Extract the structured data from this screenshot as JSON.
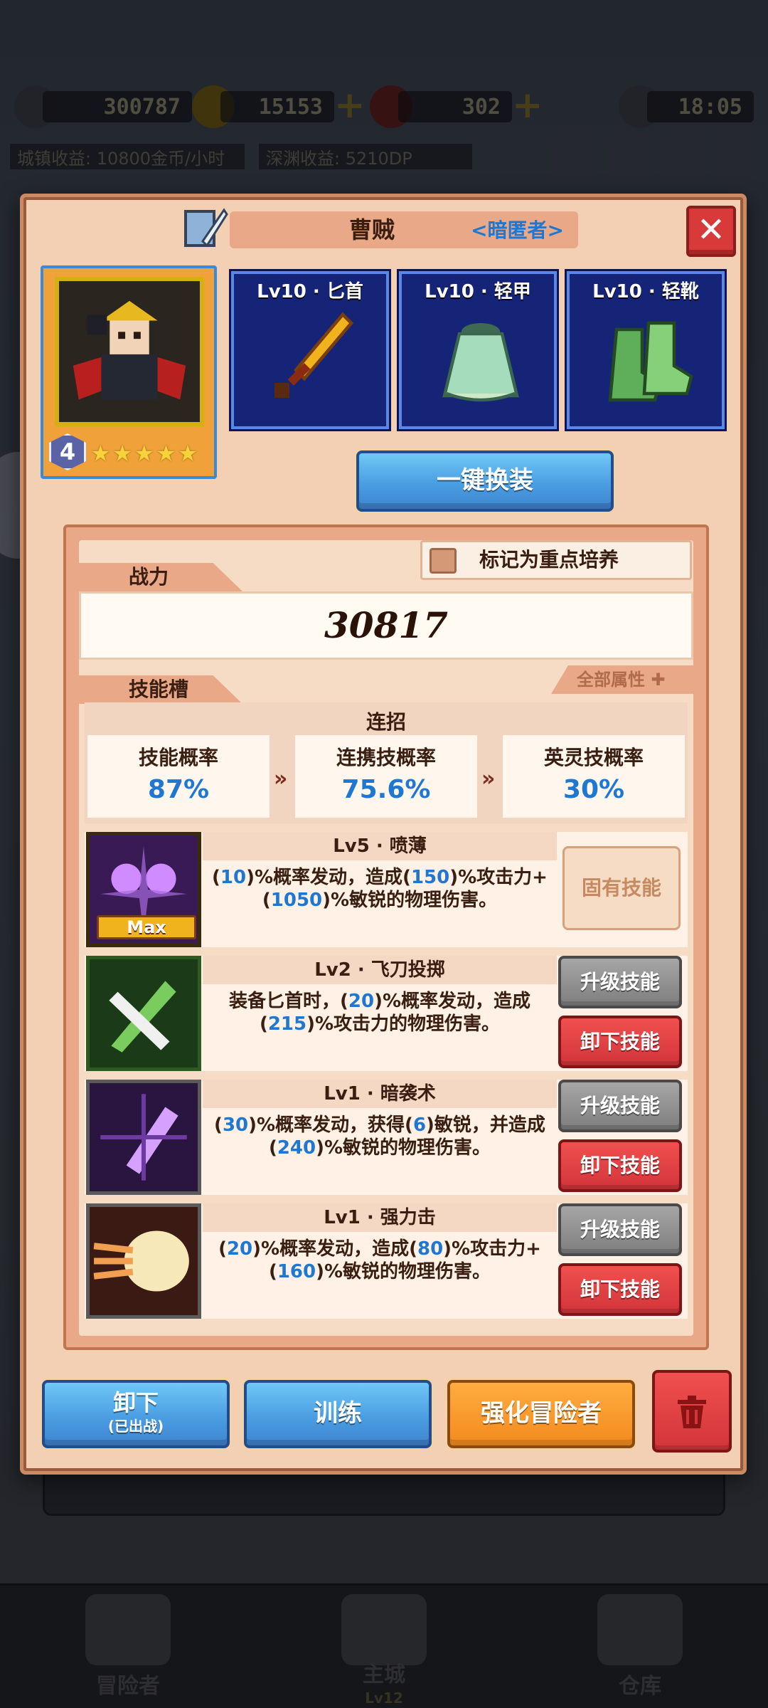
{
  "hud": {
    "diamonds": "300787",
    "gold": "15153",
    "gems": "302",
    "time": "18:05",
    "town_income": "城镇收益: 10800金币/小时",
    "abyss_income": "深渊收益: 5210DP"
  },
  "dialog": {
    "hero_name": "曹贼",
    "hero_class": "<暗匿者>",
    "close_label": "✕",
    "portrait": {
      "level": "4",
      "stars": 5
    },
    "equipment": [
      {
        "label": "Lv10 · 匕首",
        "icon": "dagger-icon"
      },
      {
        "label": "Lv10 · 轻甲",
        "icon": "light-armor-icon"
      },
      {
        "label": "Lv10 · 轻靴",
        "icon": "light-boots-icon"
      }
    ],
    "auto_equip_label": "一键换装",
    "power": {
      "tab_label": "战力",
      "value": "30817",
      "mark_label": "标记为重点培养",
      "all_attr_label": "全部属性 ✚"
    },
    "skills_tab_label": "技能槽",
    "combo": {
      "title": "连招",
      "rates": [
        {
          "label": "技能概率",
          "value": "87%"
        },
        {
          "label": "连携技概率",
          "value": "75.6%"
        },
        {
          "label": "英灵技概率",
          "value": "30%"
        }
      ]
    },
    "skills": [
      {
        "title": "Lv5 · 喷薄",
        "tag": "Max",
        "fixed_label": "固有技能",
        "desc": [
          "(",
          "10",
          ")%概率发动，造成(",
          "150",
          ")%攻击力+(",
          "1050",
          ")%敏锐的物理伤害。"
        ]
      },
      {
        "title": "Lv2 · 飞刀投掷",
        "upgrade_label": "升级技能",
        "unequip_label": "卸下技能",
        "desc": [
          "装备匕首时，(",
          "20",
          ")%概率发动，造成(",
          "215",
          ")%攻击力的物理伤害。"
        ]
      },
      {
        "title": "Lv1 · 暗袭术",
        "upgrade_label": "升级技能",
        "unequip_label": "卸下技能",
        "desc": [
          "(",
          "30",
          ")%概率发动，获得(",
          "6",
          ")敏锐，并造成(",
          "240",
          ")%敏锐的物理伤害。"
        ]
      },
      {
        "title": "Lv1 · 强力击",
        "upgrade_label": "升级技能",
        "unequip_label": "卸下技能",
        "desc": [
          "(",
          "20",
          ")%概率发动，造成(",
          "80",
          ")%攻击力+(",
          "160",
          ")%敏锐的物理伤害。"
        ]
      }
    ],
    "footer": {
      "unequip_label": "卸下",
      "unequip_sub": "(已出战)",
      "train_label": "训练",
      "enhance_label": "强化冒险者",
      "delete_icon": "trash-icon"
    }
  },
  "nav": {
    "items": [
      {
        "label": "冒险者"
      },
      {
        "label": "主城",
        "sub": "Lv12"
      },
      {
        "label": "仓库"
      }
    ]
  },
  "colors": {
    "accent_blue": "#1e78d2",
    "frame_orange": "#e9a988",
    "danger_red": "#d83a3a"
  }
}
